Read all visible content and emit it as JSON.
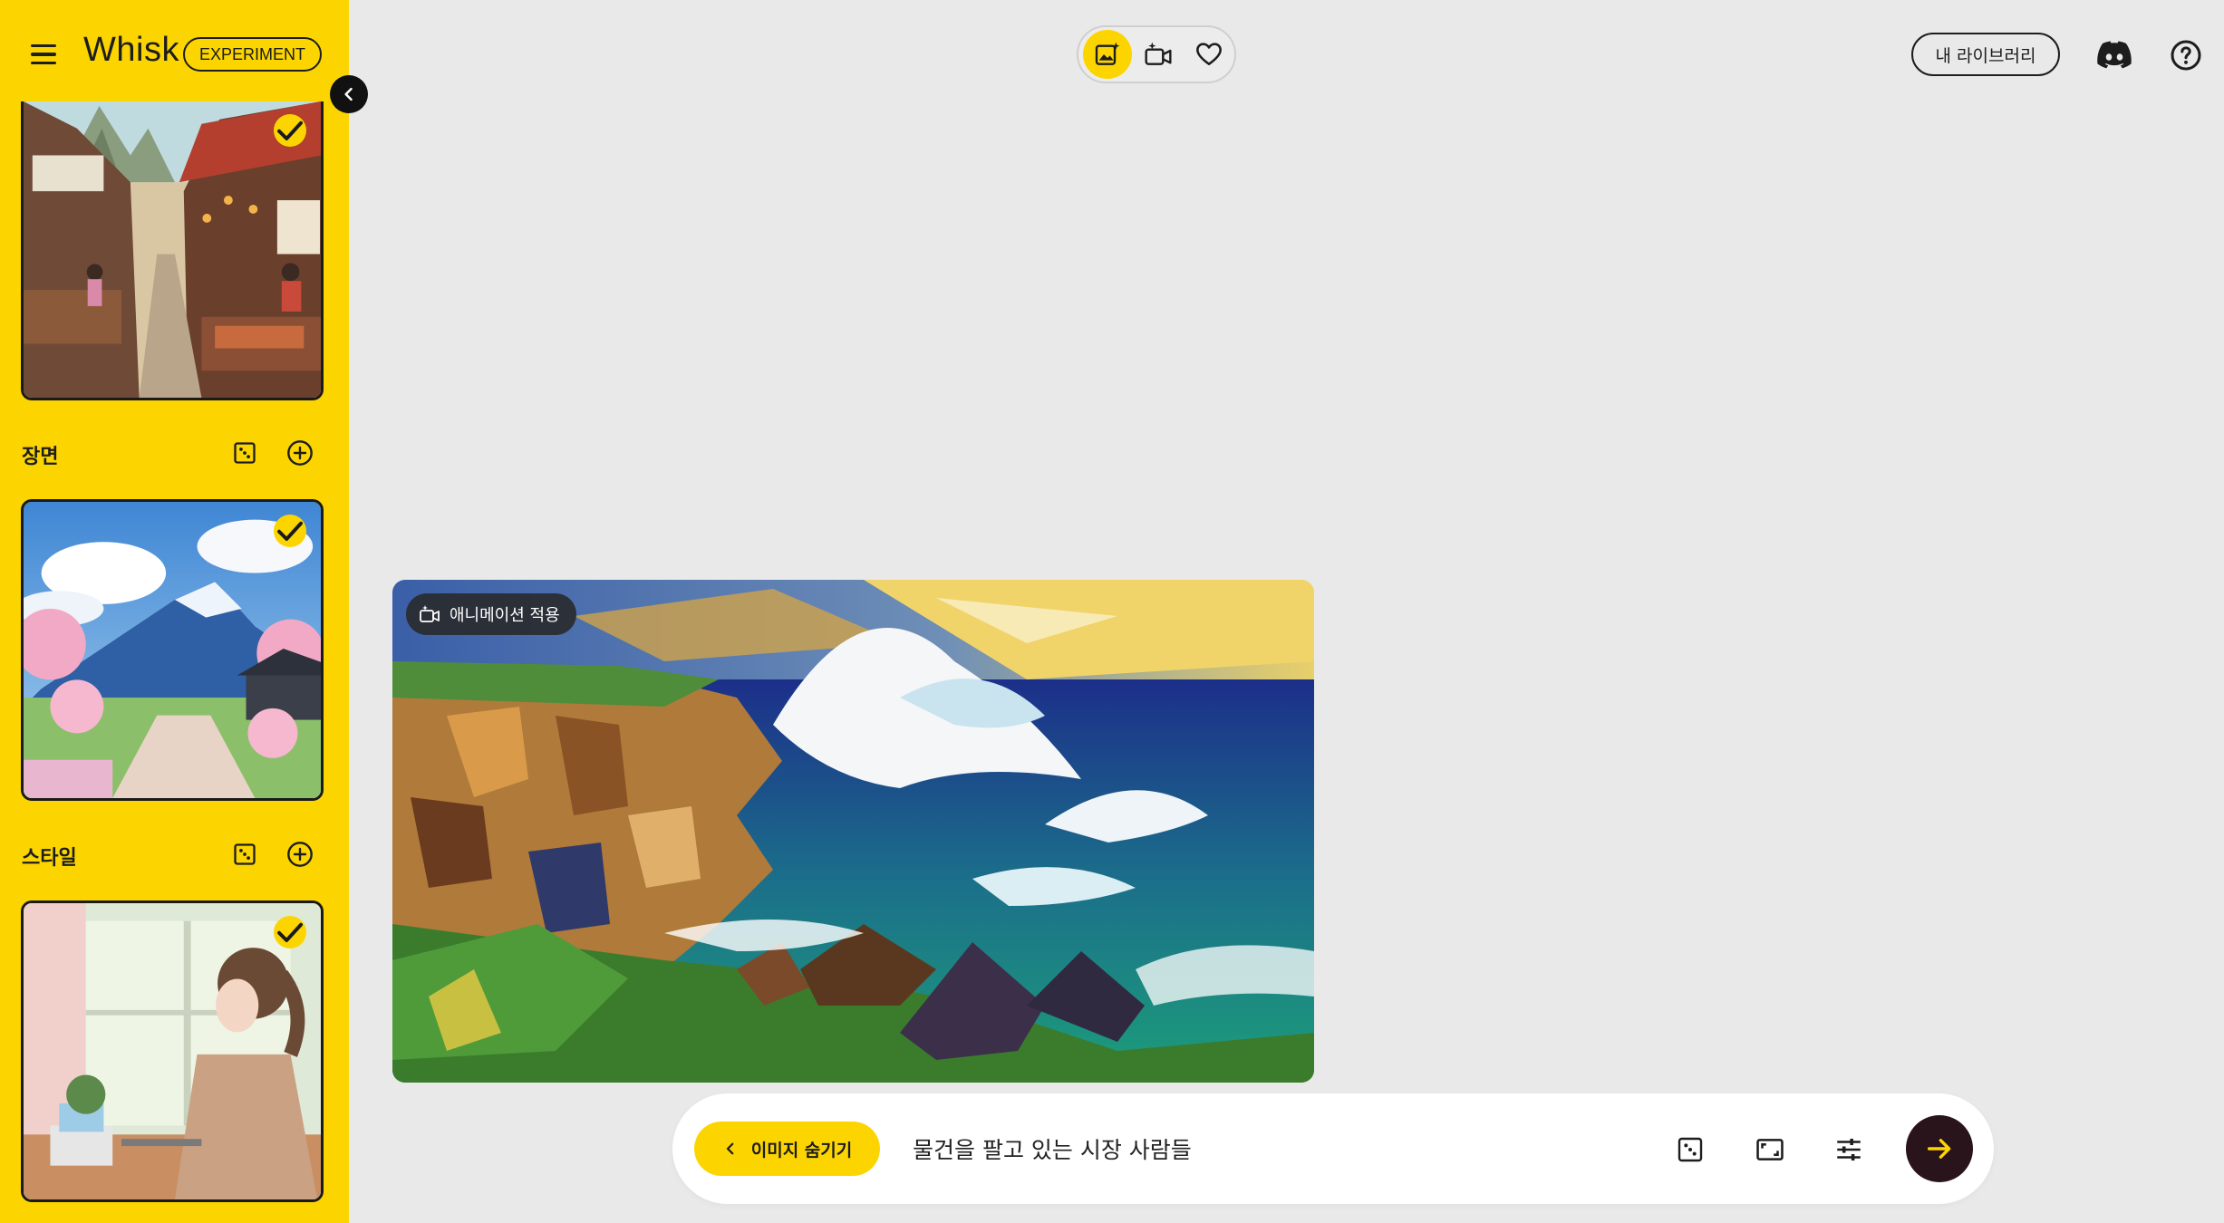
{
  "app": {
    "name": "Whisk",
    "badge": "EXPERIMENT"
  },
  "icons": {
    "menu": "menu-icon",
    "collapse": "chevron-left-icon",
    "dice": "dice-icon",
    "add": "add-circle-icon",
    "check": "check-icon",
    "image_mode": "image-sparkle-icon",
    "video_mode": "video-sparkle-icon",
    "favorites": "heart-icon",
    "discord": "discord-icon",
    "help": "help-icon",
    "aspect": "aspect-ratio-icon",
    "settings": "tune-icon",
    "submit": "arrow-right-icon"
  },
  "colors": {
    "accent": "#fcd500",
    "dark": "#2a141b",
    "background": "#e9e9e9"
  },
  "sidebar": {
    "sections": [
      {
        "title": "",
        "selected": true
      },
      {
        "title": "장면",
        "selected": true
      },
      {
        "title": "스타일",
        "selected": true
      }
    ]
  },
  "header": {
    "library_label": "내 라이브러리"
  },
  "main": {
    "animate_label": "애니메이션 적용"
  },
  "prompt": {
    "hide_images_label": "이미지 숨기기",
    "text": "물건을 팔고 있는 시장 사람들"
  }
}
